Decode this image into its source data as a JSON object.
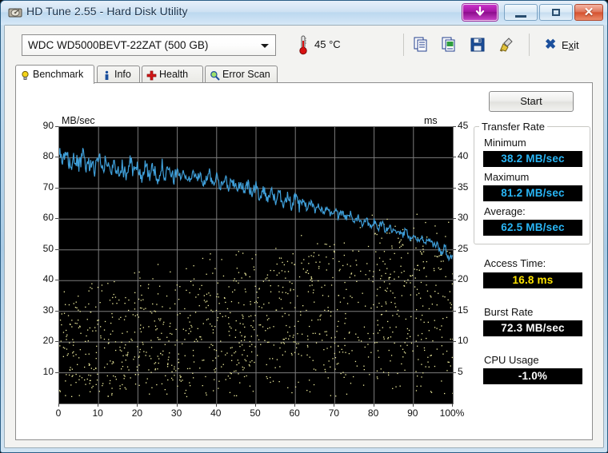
{
  "window": {
    "title": "HD Tune 2.55 - Hard Disk Utility",
    "app_icon": "hdd-icon",
    "buttons": {
      "download": "download-arrow",
      "minimize": "–",
      "maximize": "□",
      "close": "✕"
    }
  },
  "toolbar": {
    "drive": "WDC WD5000BEVT-22ZAT (500 GB)",
    "drive_caret": "▼",
    "temperature": "45 °C",
    "temp_icon": "thermometer-icon",
    "icons": [
      {
        "name": "copy-text-icon",
        "tip": "Copy text"
      },
      {
        "name": "copy-image-icon",
        "tip": "Copy image"
      },
      {
        "name": "save-icon",
        "tip": "Save"
      },
      {
        "name": "options-icon",
        "tip": "Options"
      }
    ],
    "exit_label_pre": "E",
    "exit_label_accel": "x",
    "exit_label_post": "it",
    "exit_icon": "blue-x-icon"
  },
  "tabs": [
    {
      "label": "Benchmark",
      "icon": "lightbulb-icon",
      "active": true
    },
    {
      "label": "Info",
      "icon": "info-icon",
      "active": false
    },
    {
      "label": "Health",
      "icon": "red-cross-icon",
      "active": false
    },
    {
      "label": "Error Scan",
      "icon": "magnifier-icon",
      "active": false
    }
  ],
  "side": {
    "start_label": "Start",
    "transfer_rate_title": "Transfer Rate",
    "minimum_label": "Minimum",
    "minimum_value": "38.2 MB/sec",
    "maximum_label": "Maximum",
    "maximum_value": "81.2 MB/sec",
    "average_label": "Average:",
    "average_value": "62.5 MB/sec",
    "access_time_label": "Access Time:",
    "access_time_value": "16.8 ms",
    "burst_rate_label": "Burst Rate",
    "burst_rate_value": "72.3 MB/sec",
    "cpu_usage_label": "CPU Usage",
    "cpu_usage_value": "-1.0%"
  },
  "colors": {
    "transfer_line": "#3f9fd9",
    "access_dots": "#f2f0a0",
    "plot_bg": "#000000",
    "grid": "#7c7c7c",
    "value_cyan": "#29b6f6",
    "value_yellow": "#ffe400",
    "value_white": "#ffffff"
  },
  "chart_data": {
    "type": "line",
    "title": "",
    "xlabel": "",
    "ylabel": "MB/sec",
    "y2label": "ms",
    "xlim": [
      0,
      100
    ],
    "ylim": [
      0,
      90
    ],
    "y2lim": [
      0,
      45
    ],
    "grid": true,
    "legend": "none",
    "xticks": [
      "0",
      "10",
      "20",
      "30",
      "40",
      "50",
      "60",
      "70",
      "80",
      "90",
      "100%"
    ],
    "xtick_values": [
      0,
      10,
      20,
      30,
      40,
      50,
      60,
      70,
      80,
      90,
      100
    ],
    "yticks": [
      "10",
      "20",
      "30",
      "40",
      "50",
      "60",
      "70",
      "80",
      "90"
    ],
    "ytick_values": [
      10,
      20,
      30,
      40,
      50,
      60,
      70,
      80,
      90
    ],
    "y2ticks": [
      "5",
      "10",
      "15",
      "20",
      "25",
      "30",
      "35",
      "40",
      "45"
    ],
    "y2tick_values": [
      5,
      10,
      15,
      20,
      25,
      30,
      35,
      40,
      45
    ],
    "series": [
      {
        "name": "Transfer rate",
        "axis": "left",
        "unit": "MB/sec",
        "color": "#3f9fd9",
        "x": [
          0,
          1,
          2,
          3,
          4,
          5,
          6,
          7,
          8,
          9,
          10,
          11,
          12,
          13,
          14,
          15,
          16,
          17,
          18,
          19,
          20,
          21,
          22,
          23,
          24,
          25,
          26,
          27,
          28,
          29,
          30,
          31,
          32,
          33,
          34,
          35,
          36,
          37,
          38,
          39,
          40,
          41,
          42,
          43,
          44,
          45,
          46,
          47,
          48,
          49,
          50,
          51,
          52,
          53,
          54,
          55,
          56,
          57,
          58,
          59,
          60,
          61,
          62,
          63,
          64,
          65,
          66,
          67,
          68,
          69,
          70,
          71,
          72,
          73,
          74,
          75,
          76,
          77,
          78,
          79,
          80,
          81,
          82,
          83,
          84,
          85,
          86,
          87,
          88,
          89,
          90,
          91,
          92,
          93,
          94,
          95,
          96,
          97,
          98,
          99,
          100
        ],
        "y": [
          81.0,
          78.6,
          80.2,
          77.4,
          79.8,
          76.9,
          80.6,
          77.2,
          78.4,
          75.8,
          81.2,
          76.0,
          79.4,
          74.8,
          78.2,
          76.4,
          77.0,
          74.4,
          78.8,
          75.2,
          76.8,
          73.9,
          77.6,
          74.6,
          76.2,
          73.2,
          77.8,
          74.0,
          75.6,
          72.8,
          76.4,
          73.4,
          75.0,
          72.2,
          75.8,
          72.6,
          74.4,
          71.4,
          75.2,
          71.8,
          74.0,
          70.8,
          73.6,
          70.2,
          73.0,
          69.6,
          72.2,
          68.8,
          71.4,
          68.0,
          70.6,
          67.2,
          69.8,
          66.6,
          69.0,
          66.0,
          68.4,
          65.2,
          67.8,
          64.6,
          67.0,
          64.0,
          66.2,
          63.4,
          65.6,
          62.8,
          64.8,
          62.0,
          64.0,
          61.4,
          63.2,
          60.6,
          62.4,
          60.0,
          61.8,
          59.2,
          61.0,
          58.6,
          60.2,
          57.8,
          59.4,
          57.0,
          58.6,
          56.2,
          57.8,
          55.4,
          57.0,
          54.6,
          56.2,
          53.8,
          55.4,
          53.0,
          54.6,
          52.0,
          53.6,
          50.8,
          52.4,
          49.0,
          51.0,
          46.6,
          48.0
        ]
      },
      {
        "name": "Access time",
        "axis": "right",
        "unit": "ms",
        "color": "#f2f0a0",
        "note": "scatter cloud of individual seek samples, mostly 6-22 ms rising toward ~10-22 ms across the disk"
      }
    ]
  }
}
